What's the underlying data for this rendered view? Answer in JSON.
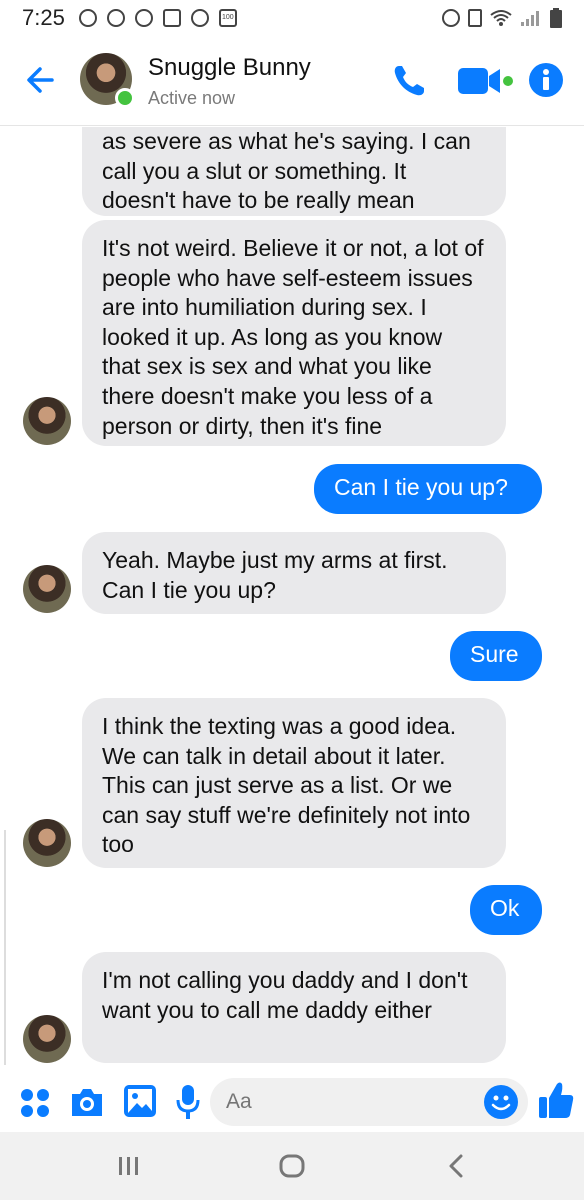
{
  "status_bar": {
    "time": "7:25",
    "battery_label": "100"
  },
  "header": {
    "contact_name": "Snuggle Bunny",
    "status": "Active now"
  },
  "colors": {
    "accent": "#0a7cff",
    "incoming_bubble": "#e9e9eb",
    "online": "#44c33f"
  },
  "messages": [
    {
      "from": "them",
      "text": "as severe as what he's saying. I can call you a slut or something. It doesn't have to be really mean"
    },
    {
      "from": "them",
      "text": "It's not weird. Believe it or not, a lot of people who have self-esteem issues are into humiliation during sex. I looked it up. As long as you know that sex is sex and what you like there doesn't make you less of a person or dirty, then it's fine"
    },
    {
      "from": "me",
      "text": "Can I tie you up?"
    },
    {
      "from": "them",
      "text": "Yeah. Maybe just my arms at first. Can I tie you up?"
    },
    {
      "from": "me",
      "text": "Sure"
    },
    {
      "from": "them",
      "text": "I think the texting was a good idea. We can talk in detail about it later. This can just serve as a list. Or we can say stuff we're definitely not into too"
    },
    {
      "from": "me",
      "text": "Ok"
    },
    {
      "from": "them",
      "text": "I'm not calling you daddy and I don't want you to call me daddy either"
    }
  ],
  "composer": {
    "placeholder": "Aa",
    "icons": [
      "apps-icon",
      "camera-icon",
      "gallery-icon",
      "microphone-icon",
      "emoji-icon",
      "thumbs-up-icon"
    ]
  },
  "navigation": {
    "icons": [
      "recent-apps-icon",
      "home-icon",
      "back-icon"
    ]
  }
}
